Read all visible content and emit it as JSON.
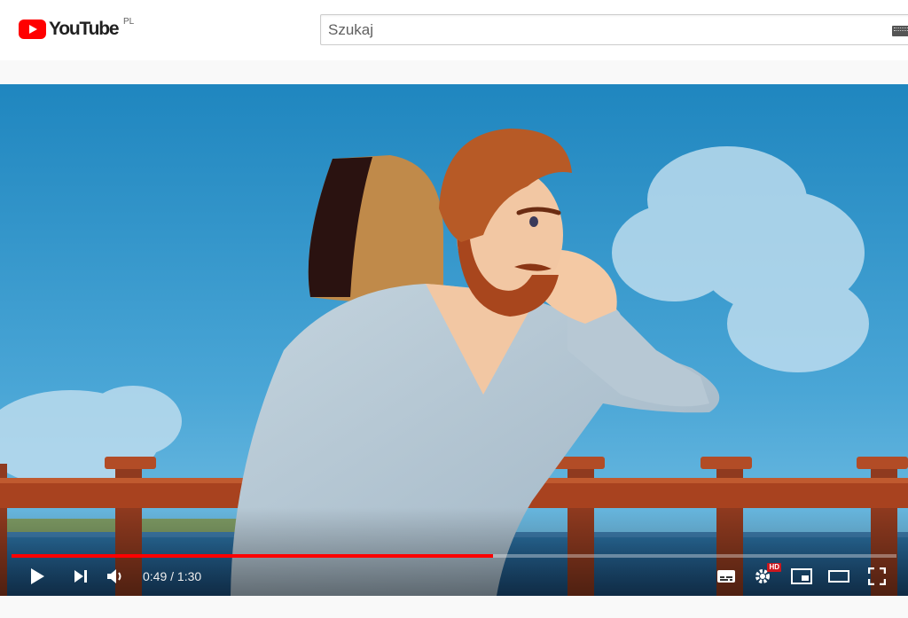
{
  "header": {
    "logo_text": "YouTube",
    "country_code": "PL",
    "search_placeholder": "Szukaj",
    "search_value": ""
  },
  "player": {
    "current_time": "0:49",
    "separator": " / ",
    "duration": "1:30",
    "progress_fraction": 0.544,
    "buffered_fraction": 0.544,
    "hd_badge": "HD",
    "icons": {
      "play": "play-icon",
      "next": "next-icon",
      "volume": "volume-icon",
      "subtitles": "subtitles-icon",
      "settings": "settings-gear-icon",
      "miniplayer": "miniplayer-icon",
      "theater": "theater-mode-icon",
      "fullscreen": "fullscreen-icon"
    },
    "colors": {
      "progress_played": "#ff0000",
      "logo_red": "#ff0000",
      "hd_badge": "#cc181e"
    }
  }
}
